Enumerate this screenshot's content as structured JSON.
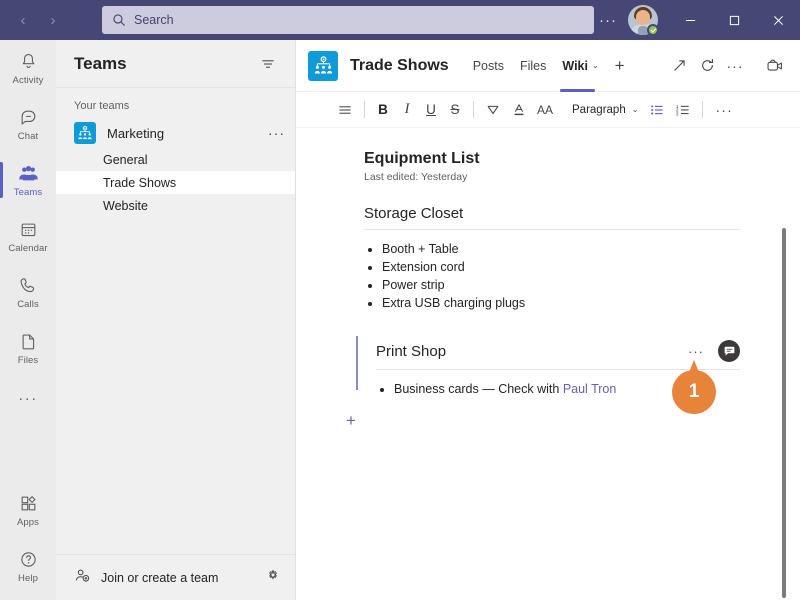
{
  "titlebar": {
    "back_label": "‹",
    "forward_label": "›",
    "search_placeholder": "Search",
    "search_icon": "search-icon",
    "more_label": "···",
    "minimize_label": "—",
    "maximize_label": "▢",
    "close_label": "✕",
    "presence_status": "Available",
    "bg_color": "#464775"
  },
  "rail": {
    "items": [
      {
        "label": "Activity",
        "icon": "bell-icon",
        "selected": false
      },
      {
        "label": "Chat",
        "icon": "chat-bubble-icon",
        "selected": false
      },
      {
        "label": "Teams",
        "icon": "people-icon",
        "selected": true
      },
      {
        "label": "Calendar",
        "icon": "calendar-icon",
        "selected": false
      },
      {
        "label": "Calls",
        "icon": "phone-icon",
        "selected": false
      },
      {
        "label": "Files",
        "icon": "file-icon",
        "selected": false
      }
    ],
    "more_label": "···",
    "bottom_items": [
      {
        "label": "Apps",
        "icon": "apps-icon"
      },
      {
        "label": "Help",
        "icon": "help-icon"
      }
    ],
    "accent_color": "#5b5fc7"
  },
  "teams_panel": {
    "title": "Teams",
    "filter_icon": "filter-icon",
    "group_label": "Your teams",
    "team": {
      "name": "Marketing",
      "avatar_icon": "team-org-icon",
      "avatar_color": "#0f9bd7",
      "more_label": "···"
    },
    "channels": [
      {
        "name": "General",
        "selected": false
      },
      {
        "name": "Trade Shows",
        "selected": true
      },
      {
        "name": "Website",
        "selected": false
      }
    ],
    "footer": {
      "join_label": "Join or create a team",
      "join_icon": "person-add-icon",
      "settings_icon": "gear-icon"
    }
  },
  "channel_header": {
    "avatar_icon": "team-org-icon",
    "title": "Trade Shows",
    "tabs": [
      {
        "label": "Posts",
        "active": false
      },
      {
        "label": "Files",
        "active": false
      },
      {
        "label": "Wiki",
        "active": true
      }
    ],
    "tab_chevron": "⌄",
    "add_tab_label": "+",
    "actions": [
      {
        "icon": "expand-icon",
        "name": "popout-button"
      },
      {
        "icon": "refresh-icon",
        "name": "refresh-button"
      },
      {
        "icon": "more-icon",
        "name": "more-options-button",
        "label": "···"
      },
      {
        "icon": "meet-now-icon",
        "name": "meet-now-button"
      }
    ]
  },
  "toolbar": {
    "expand_icon": "format-expand-icon",
    "bold_label": "B",
    "italic_label": "I",
    "underline_label": "U",
    "strikethrough_label": "S",
    "highlight_icon": "highlight-icon",
    "font_color_icon": "font-color-icon",
    "font_size_label": "AA",
    "paragraph_label": "Paragraph",
    "paragraph_chevron": "⌄",
    "bulleted_list_icon": "bulleted-list-icon",
    "numbered_list_icon": "numbered-list-icon",
    "more_label": "···"
  },
  "document": {
    "title": "Equipment List",
    "subtitle": "Last edited: Yesterday",
    "sections": [
      {
        "heading": "Storage Closet",
        "items": [
          {
            "text": "Booth + Table"
          },
          {
            "text": "Extension cord"
          },
          {
            "text": "Power strip"
          },
          {
            "text": "Extra USB charging plugs"
          }
        ]
      },
      {
        "heading": "Print Shop",
        "more_label": "···",
        "comment_icon": "comment-icon",
        "items": [
          {
            "text": "Business cards — Check with ",
            "mention": "Paul Tron"
          }
        ]
      }
    ],
    "add_section_label": "+"
  },
  "callout": {
    "number": "1",
    "color": "#e8833a"
  }
}
